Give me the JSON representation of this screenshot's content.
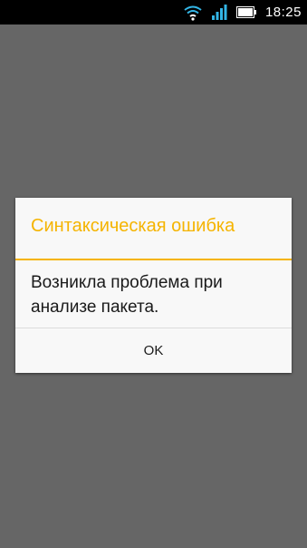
{
  "status_bar": {
    "time": "18:25",
    "icons": [
      "wifi-icon",
      "signal-icon",
      "battery-icon"
    ]
  },
  "dialog": {
    "title": "Синтаксическая ошибка",
    "message": "Возникла проблема при анализе пакета.",
    "ok_label": "OK"
  },
  "colors": {
    "background": "#666666",
    "accent": "#f5b400",
    "dialog_bg": "#f8f8f8",
    "status_bar": "#000000"
  }
}
